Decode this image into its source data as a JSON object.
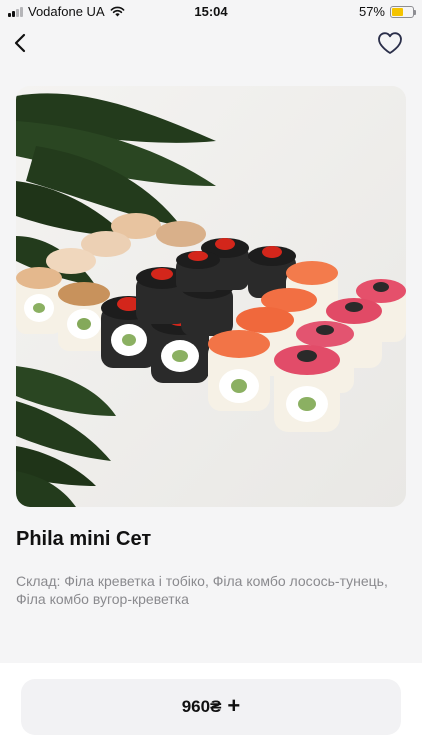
{
  "status_bar": {
    "carrier": "Vodafone UA",
    "time": "15:04",
    "battery": "57%",
    "battery_level": 0.57,
    "battery_color": "#f5c400"
  },
  "nav": {
    "back_icon": "chevron-left-icon",
    "favorite_icon": "heart-outline-icon"
  },
  "product": {
    "image_alt": "sushi set photo",
    "title": "Phila mini Сет",
    "description": "Склад: Філа креветка і тобіко, Філа комбо лосось-тунець, Філа комбо вугор-креветка"
  },
  "cart": {
    "price": "960₴",
    "plus_icon": "plus-icon",
    "plus_glyph": "+"
  }
}
